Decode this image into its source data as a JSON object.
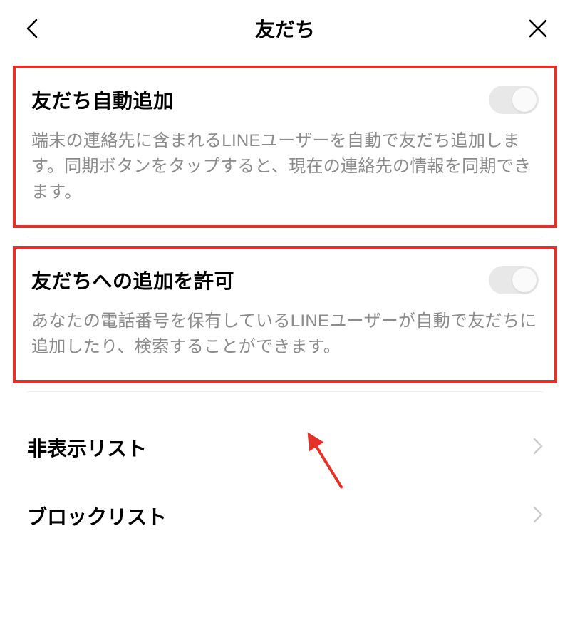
{
  "header": {
    "title": "友だち"
  },
  "sections": {
    "auto_add": {
      "title": "友だち自動追加",
      "description": "端末の連絡先に含まれるLINEユーザーを自動で友だち追加します。同期ボタンをタップすると、現在の連絡先の情報を同期できます。",
      "toggle_state": "off"
    },
    "allow_add": {
      "title": "友だちへの追加を許可",
      "description": "あなたの電話番号を保有しているLINEユーザーが自動で友だちに追加したり、検索することができます。",
      "toggle_state": "off"
    }
  },
  "list_items": {
    "hidden_list": {
      "title": "非表示リスト"
    },
    "block_list": {
      "title": "ブロックリスト"
    }
  }
}
